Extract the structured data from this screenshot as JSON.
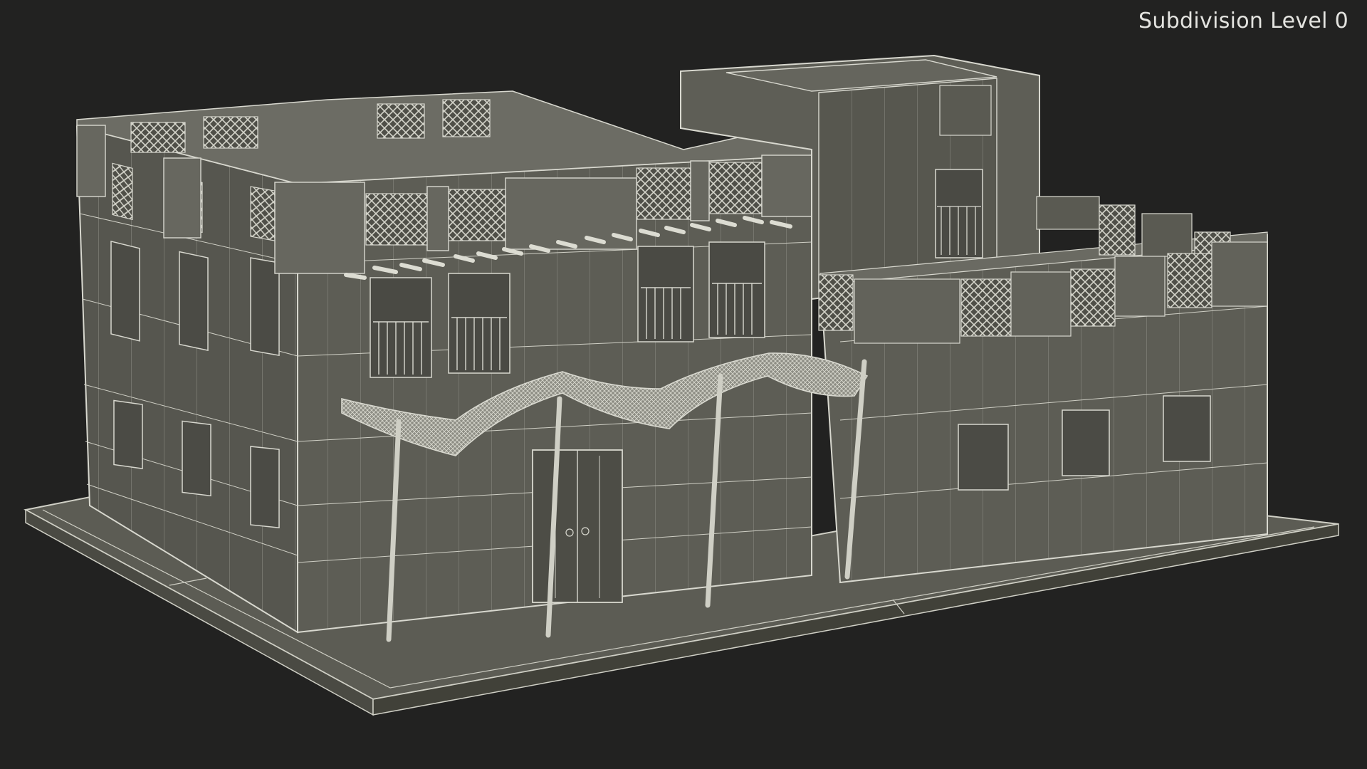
{
  "viewport": {
    "subdivision_label": "Subdivision Level 0",
    "background_color": "#222221"
  },
  "model": {
    "subject": "two-storey flat-roof house with lattice parapets and canopy, wireframe overlay",
    "surface_color": "#5a5a52",
    "wire_color": "#d8d8cf"
  }
}
